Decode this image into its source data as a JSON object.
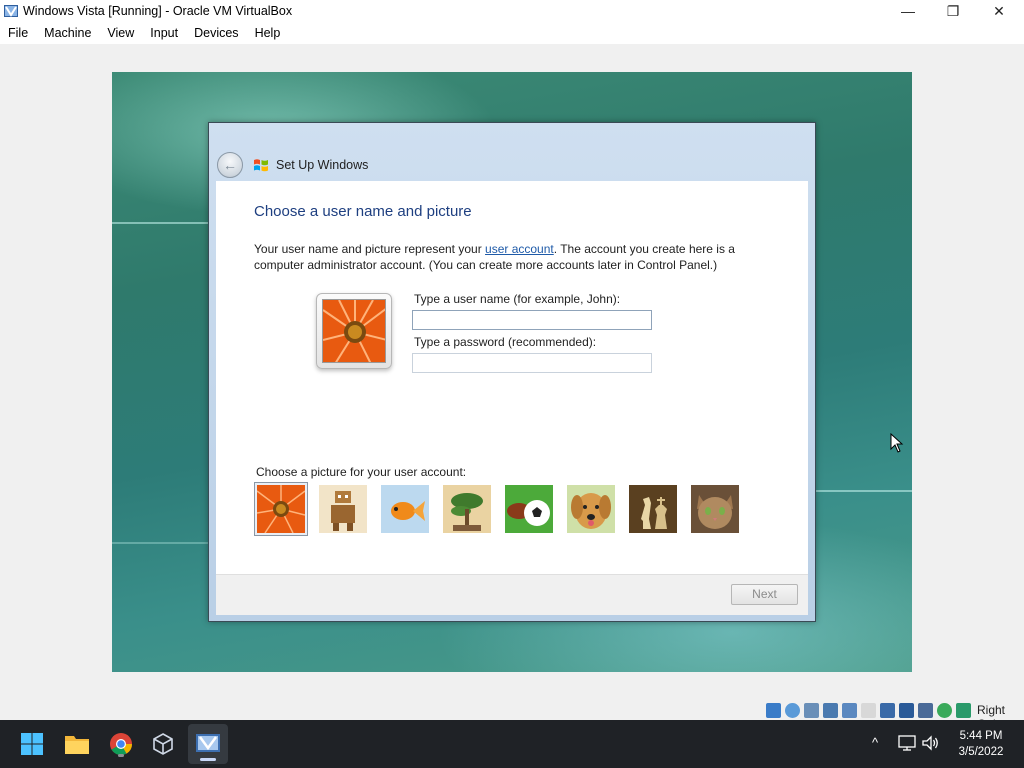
{
  "window": {
    "title": "Windows Vista [Running] - Oracle VM VirtualBox",
    "minimize": "—",
    "restore": "❐",
    "close": "✕"
  },
  "menu": [
    "File",
    "Machine",
    "View",
    "Input",
    "Devices",
    "Help"
  ],
  "setup": {
    "back_glyph": "←",
    "title": "Set Up Windows",
    "heading": "Choose a user name and picture",
    "desc_before": "Your user name and picture represent your ",
    "desc_link": "user account",
    "desc_after": ". The account you create here is a computer administrator account. (You can create more accounts later in Control Panel.)",
    "username_label": "Type a user name (for example, John):",
    "username_value": "",
    "password_label": "Type a password (recommended):",
    "password_value": "",
    "choose_label": "Choose a picture for your user account:",
    "pictures": [
      "flower",
      "robot",
      "goldfish",
      "bonsai",
      "sports-balls",
      "puppy",
      "chess",
      "kitten"
    ],
    "selected_picture": "flower",
    "next_label": "Next"
  },
  "status": {
    "host_key": "Right Ctrl"
  },
  "taskbar": {
    "apps": [
      "start",
      "file-explorer",
      "chrome",
      "virtualbox-manager",
      "virtualbox-vm"
    ],
    "active": "virtualbox-vm",
    "tray_chevron": "^",
    "time": "5:44 PM",
    "date": "3/5/2022"
  }
}
